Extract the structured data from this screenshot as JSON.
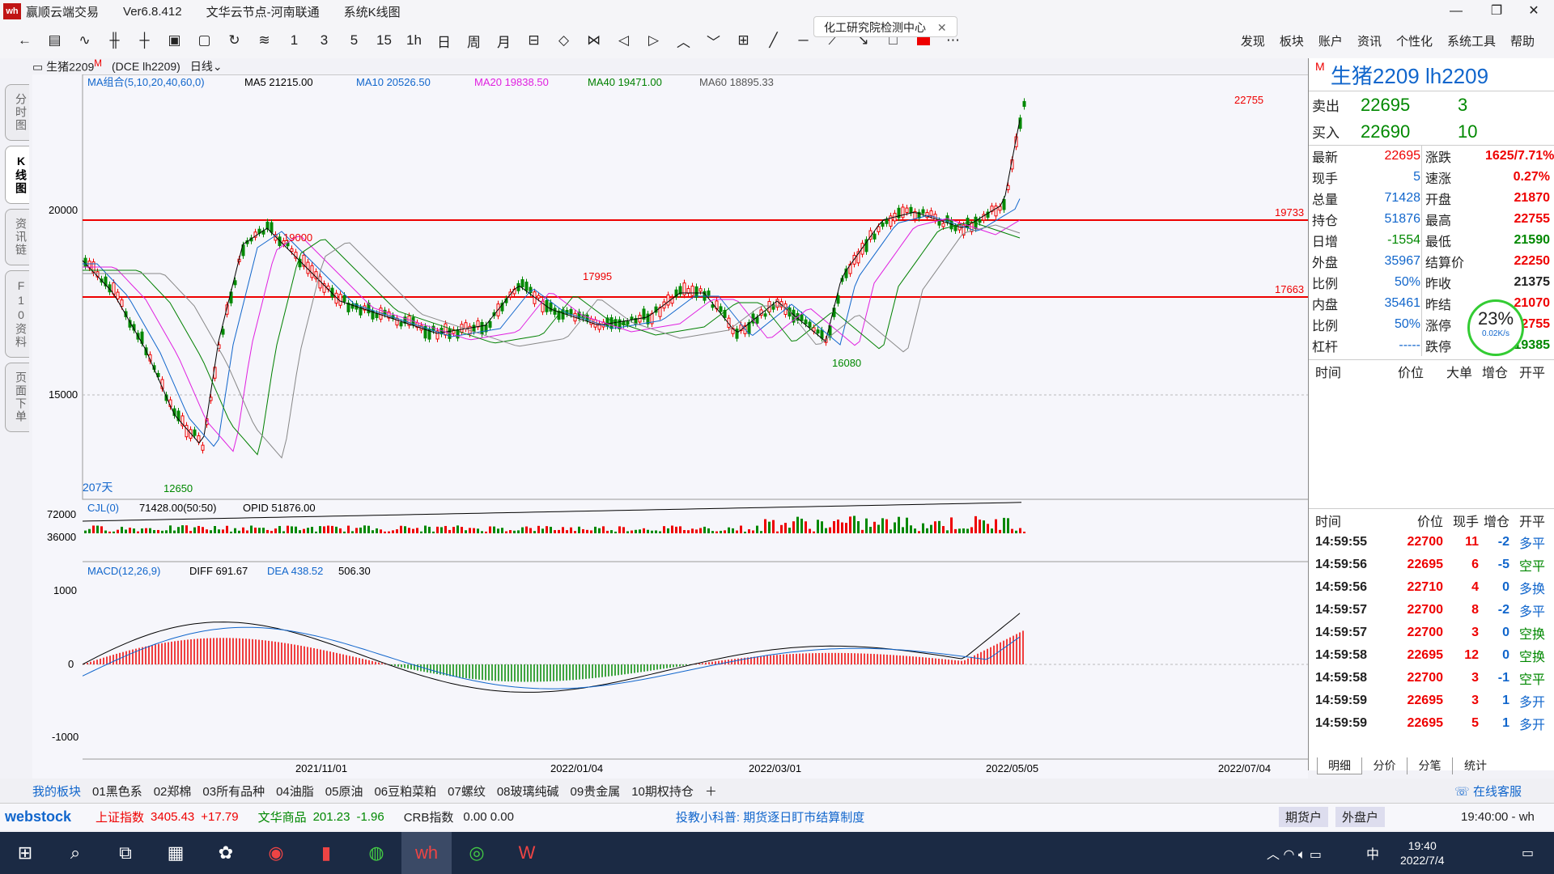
{
  "window": {
    "app": "赢顺云端交易",
    "version": "Ver6.8.412",
    "node": "文华云节点-河南联通",
    "module": "系统K线图",
    "notice": "化工研究院检测中心"
  },
  "menu": [
    "发现",
    "板块",
    "账户",
    "资讯",
    "个性化",
    "系统工具",
    "帮助"
  ],
  "toolbar": [
    "1",
    "3",
    "5",
    "15",
    "1h",
    "日",
    "周",
    "月"
  ],
  "symbar": {
    "name": "生猪2209",
    "superscript": "M",
    "code": "(DCE lh2209)",
    "period": "日线"
  },
  "sidetabs": [
    "分时图",
    "K线图",
    "资讯链",
    "F10资料",
    "页面下单"
  ],
  "ma": {
    "label": "MA组合(5,10,20,40,60,0)",
    "ma5": "MA5 21215.00",
    "ma10": "MA10 20526.50",
    "ma20": "MA20 19838.50",
    "ma40": "MA40 19471.00",
    "ma60": "MA60 18895.33"
  },
  "price_axis": [
    "20000",
    "15000"
  ],
  "annotations": [
    "22755",
    "19000",
    "17995",
    "16080",
    "12650",
    "19733",
    "17663",
    "207天"
  ],
  "vol": {
    "label": "CJL(0)",
    "value": "71428.00(50:50)",
    "opid": "OPID 51876.00",
    "axis": [
      "72000",
      "36000"
    ]
  },
  "macd": {
    "label": "MACD(12,26,9)",
    "diff": "DIFF 691.67",
    "dea": "DEA 438.52",
    "macd": "506.30",
    "axis": [
      "1000",
      "0",
      "-1000"
    ]
  },
  "dates": [
    "2021/11/01",
    "2022/01/04",
    "2022/03/01",
    "2022/05/05",
    "2022/07/04"
  ],
  "quote": {
    "title": "生猪2209  lh2209",
    "ask_label": "卖出",
    "ask": "22695",
    "ask_vol": "3",
    "bid_label": "买入",
    "bid": "22690",
    "bid_vol": "10",
    "left": [
      [
        "最新",
        "22695"
      ],
      [
        "现手",
        "5"
      ],
      [
        "总量",
        "71428"
      ],
      [
        "持仓",
        "51876"
      ],
      [
        "日增",
        "-1554"
      ],
      [
        "外盘",
        "35967"
      ],
      [
        "比例",
        "50%"
      ],
      [
        "内盘",
        "35461"
      ],
      [
        "比例",
        "50%"
      ],
      [
        "杠杆",
        "-----"
      ]
    ],
    "right": [
      [
        "涨跌",
        "1625/7.71%"
      ],
      [
        "速涨",
        "0.27%"
      ],
      [
        "开盘",
        "21870"
      ],
      [
        "最高",
        "22755"
      ],
      [
        "最低",
        "21590"
      ],
      [
        "结算价",
        "22250"
      ],
      [
        "昨收",
        "21375"
      ],
      [
        "昨结",
        "21070"
      ],
      [
        "涨停",
        "22755"
      ],
      [
        "跌停",
        "19385"
      ]
    ],
    "gauge": "23%",
    "gauge_speed": "0.02K/s"
  },
  "ticks_header": [
    "时间",
    "价位",
    "现手",
    "增仓",
    "开平"
  ],
  "ticks": [
    [
      "14:59:55",
      "22700",
      "11",
      "-2",
      "多平"
    ],
    [
      "14:59:56",
      "22695",
      "6",
      "-5",
      "空平"
    ],
    [
      "14:59:56",
      "22710",
      "4",
      "0",
      "多换"
    ],
    [
      "14:59:57",
      "22700",
      "8",
      "-2",
      "多平"
    ],
    [
      "14:59:57",
      "22700",
      "3",
      "0",
      "空换"
    ],
    [
      "14:59:58",
      "22695",
      "12",
      "0",
      "空换"
    ],
    [
      "14:59:58",
      "22700",
      "3",
      "-1",
      "空平"
    ],
    [
      "14:59:59",
      "22695",
      "3",
      "1",
      "多开"
    ],
    [
      "14:59:59",
      "22695",
      "5",
      "1",
      "多开"
    ]
  ],
  "upper_header": [
    "时间",
    "价位",
    "大单",
    "增仓",
    "开平"
  ],
  "rp_tabs": [
    "明细",
    "分价",
    "分笔",
    "统计"
  ],
  "bottom_tabs": [
    "我的板块",
    "01黑色系",
    "02郑棉",
    "03所有品种",
    "04油脂",
    "05原油",
    "06豆粕菜粕",
    "07螺纹",
    "08玻璃纯碱",
    "09贵金属",
    "10期权持仓"
  ],
  "status": {
    "brand": "webstock",
    "sh": "上证指数",
    "sh_val": "3405.43",
    "sh_chg": "+17.79",
    "wh": "文华商品",
    "wh_val": "201.23",
    "wh_chg": "-1.96",
    "crb": "CRB指数",
    "crb_val": "0.00 0.00",
    "tip": "投教小科普: 期货逐日盯市结算制度",
    "b1": "期货户",
    "b2": "外盘户",
    "time": "19:40:00 - wh",
    "service": "在线客服"
  },
  "taskbar": {
    "time": "19:40",
    "date": "2022/7/4",
    "ime": "中"
  }
}
